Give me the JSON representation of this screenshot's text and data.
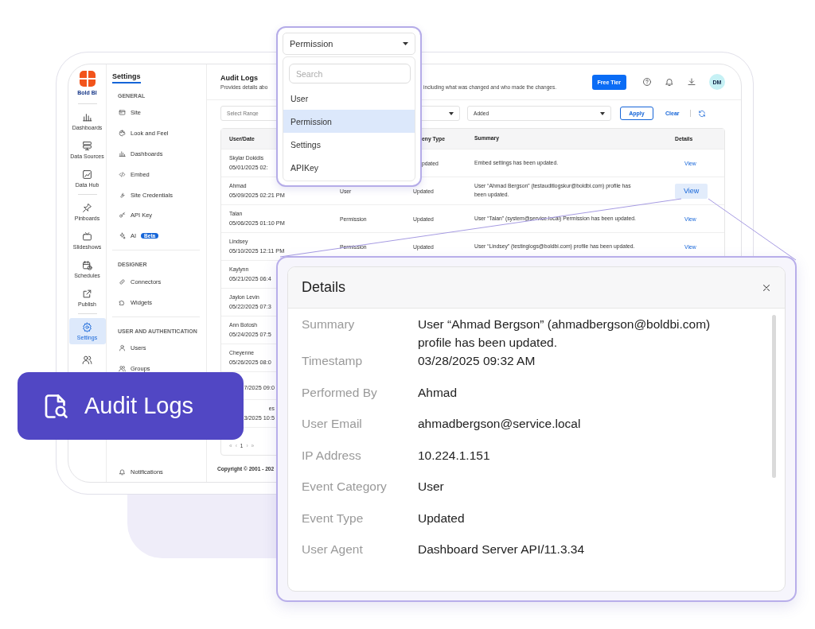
{
  "rail": {
    "brand": "Bold BI",
    "groups": [
      {
        "items": [
          {
            "label": "Dashboards",
            "selected": false
          },
          {
            "label": "Data Sources",
            "selected": false
          },
          {
            "label": "Data Hub",
            "selected": false
          }
        ]
      },
      {
        "items": [
          {
            "label": "Pinboards",
            "selected": false
          },
          {
            "label": "Slideshows",
            "selected": false
          },
          {
            "label": "Schedules",
            "selected": false
          },
          {
            "label": "Publish",
            "selected": false
          }
        ]
      },
      {
        "items": [
          {
            "label": "Settings",
            "selected": true
          },
          {
            "selected": false
          }
        ]
      }
    ]
  },
  "settings_nav": {
    "title": "Settings",
    "sections": [
      {
        "heading": "GENERAL",
        "items": [
          {
            "label": "Site"
          },
          {
            "label": "Look and Feel"
          },
          {
            "label": "Dashboards"
          },
          {
            "label": "Embed"
          },
          {
            "label": "Site Credentials"
          },
          {
            "label": "API Key"
          },
          {
            "label": "AI",
            "badge": "Beta"
          }
        ]
      },
      {
        "heading": "DESIGNER",
        "items": [
          {
            "label": "Connectors"
          },
          {
            "label": "Widgets"
          }
        ]
      },
      {
        "heading": "USER AND AUTHENTICATION",
        "items": [
          {
            "label": "Users"
          },
          {
            "label": "Groups"
          }
        ]
      }
    ],
    "footer": "Notifications"
  },
  "header": {
    "title": "Audit Logs",
    "description_parts": [
      "Provides details abo",
      "including what was changed and who made the changes."
    ],
    "plan_button": "Free Tier",
    "avatar": "DM"
  },
  "filters": {
    "range_placeholder": "Select Range",
    "action_value": "Added",
    "apply": "Apply",
    "clear": "Clear"
  },
  "table": {
    "columns": {
      "user_date": "User/Date",
      "event_type": "eny Type",
      "summary": "Summary",
      "details": "Details"
    },
    "rows": [
      {
        "kind": "full",
        "name": "Skylar Dokidis",
        "date": "05/01/2025 02:",
        "type": "pdated",
        "summary": "Embed settings has been updated.",
        "action": "View",
        "highlighted": false
      },
      {
        "kind": "full",
        "name": "Ahmad",
        "date": "05/09/2025 02:21 PM",
        "category": "User",
        "type": "Updated",
        "summary": "User “Ahmad Bergson” (testauditlogskur@boldbi.com) profile has been updated.",
        "action": "View",
        "highlighted": true
      },
      {
        "kind": "full",
        "name": "Talan",
        "date": "05/06/2025 01:10 PM",
        "category": "Permission",
        "type": "Updated",
        "summary": "User “Talan” (system@service.local) Permission has been updated.",
        "action": "View",
        "highlighted": false
      },
      {
        "kind": "full",
        "name": "Lindsey",
        "date": "05/10/2025 12:11 PM",
        "category": "Permission",
        "type": "Updated",
        "summary": "User “Lindsey” (testinglogs@boldbi.com) profile has been updated.",
        "action": "View",
        "highlighted": false
      },
      {
        "kind": "full",
        "name": "Kaylynn",
        "date": "05/21/2025 06:4"
      },
      {
        "kind": "full",
        "name": "Jaylon Levin",
        "date": "05/22/2025 07:3"
      },
      {
        "kind": "full",
        "name": "Ann Botosh",
        "date": "05/24/2025 07:5"
      },
      {
        "kind": "full",
        "name": "Cheyenne",
        "date": "05/26/2025 08:0"
      },
      {
        "kind": "cut_left",
        "date": "7/2025 09:0"
      },
      {
        "kind": "cut_left",
        "name": "es",
        "date": "3/2025 10:5"
      }
    ],
    "pagination": [
      "«",
      "‹",
      "1",
      "›",
      "»"
    ]
  },
  "copyright": "Copyright © 2001 - 202",
  "dropdown": {
    "value": "Permission",
    "search_placeholder": "Search",
    "options": [
      {
        "label": "User",
        "selected": false
      },
      {
        "label": "Permission",
        "selected": true
      },
      {
        "label": "Settings",
        "selected": false
      },
      {
        "label": "APIKey",
        "selected": false
      }
    ]
  },
  "details": {
    "title": "Details",
    "fields": [
      {
        "label": "Summary",
        "value": "User “Ahmad Bergson” (ahmadbergson@boldbi.com) profile has been updated."
      },
      {
        "label": "Timestamp",
        "value": "03/28/2025 09:32 AM"
      },
      {
        "label": "Performed By",
        "value": "Ahmad"
      },
      {
        "label": "User Email",
        "value": "ahmadbergson@service.local"
      },
      {
        "label": "IP Address",
        "value": "10.224.1.151"
      },
      {
        "label": "Event Category",
        "value": "User"
      },
      {
        "label": "Event Type",
        "value": "Updated"
      },
      {
        "label": "User Agent",
        "value": "Dashboard Server API/11.3.34"
      }
    ]
  },
  "badge": {
    "label": "Audit Logs"
  }
}
